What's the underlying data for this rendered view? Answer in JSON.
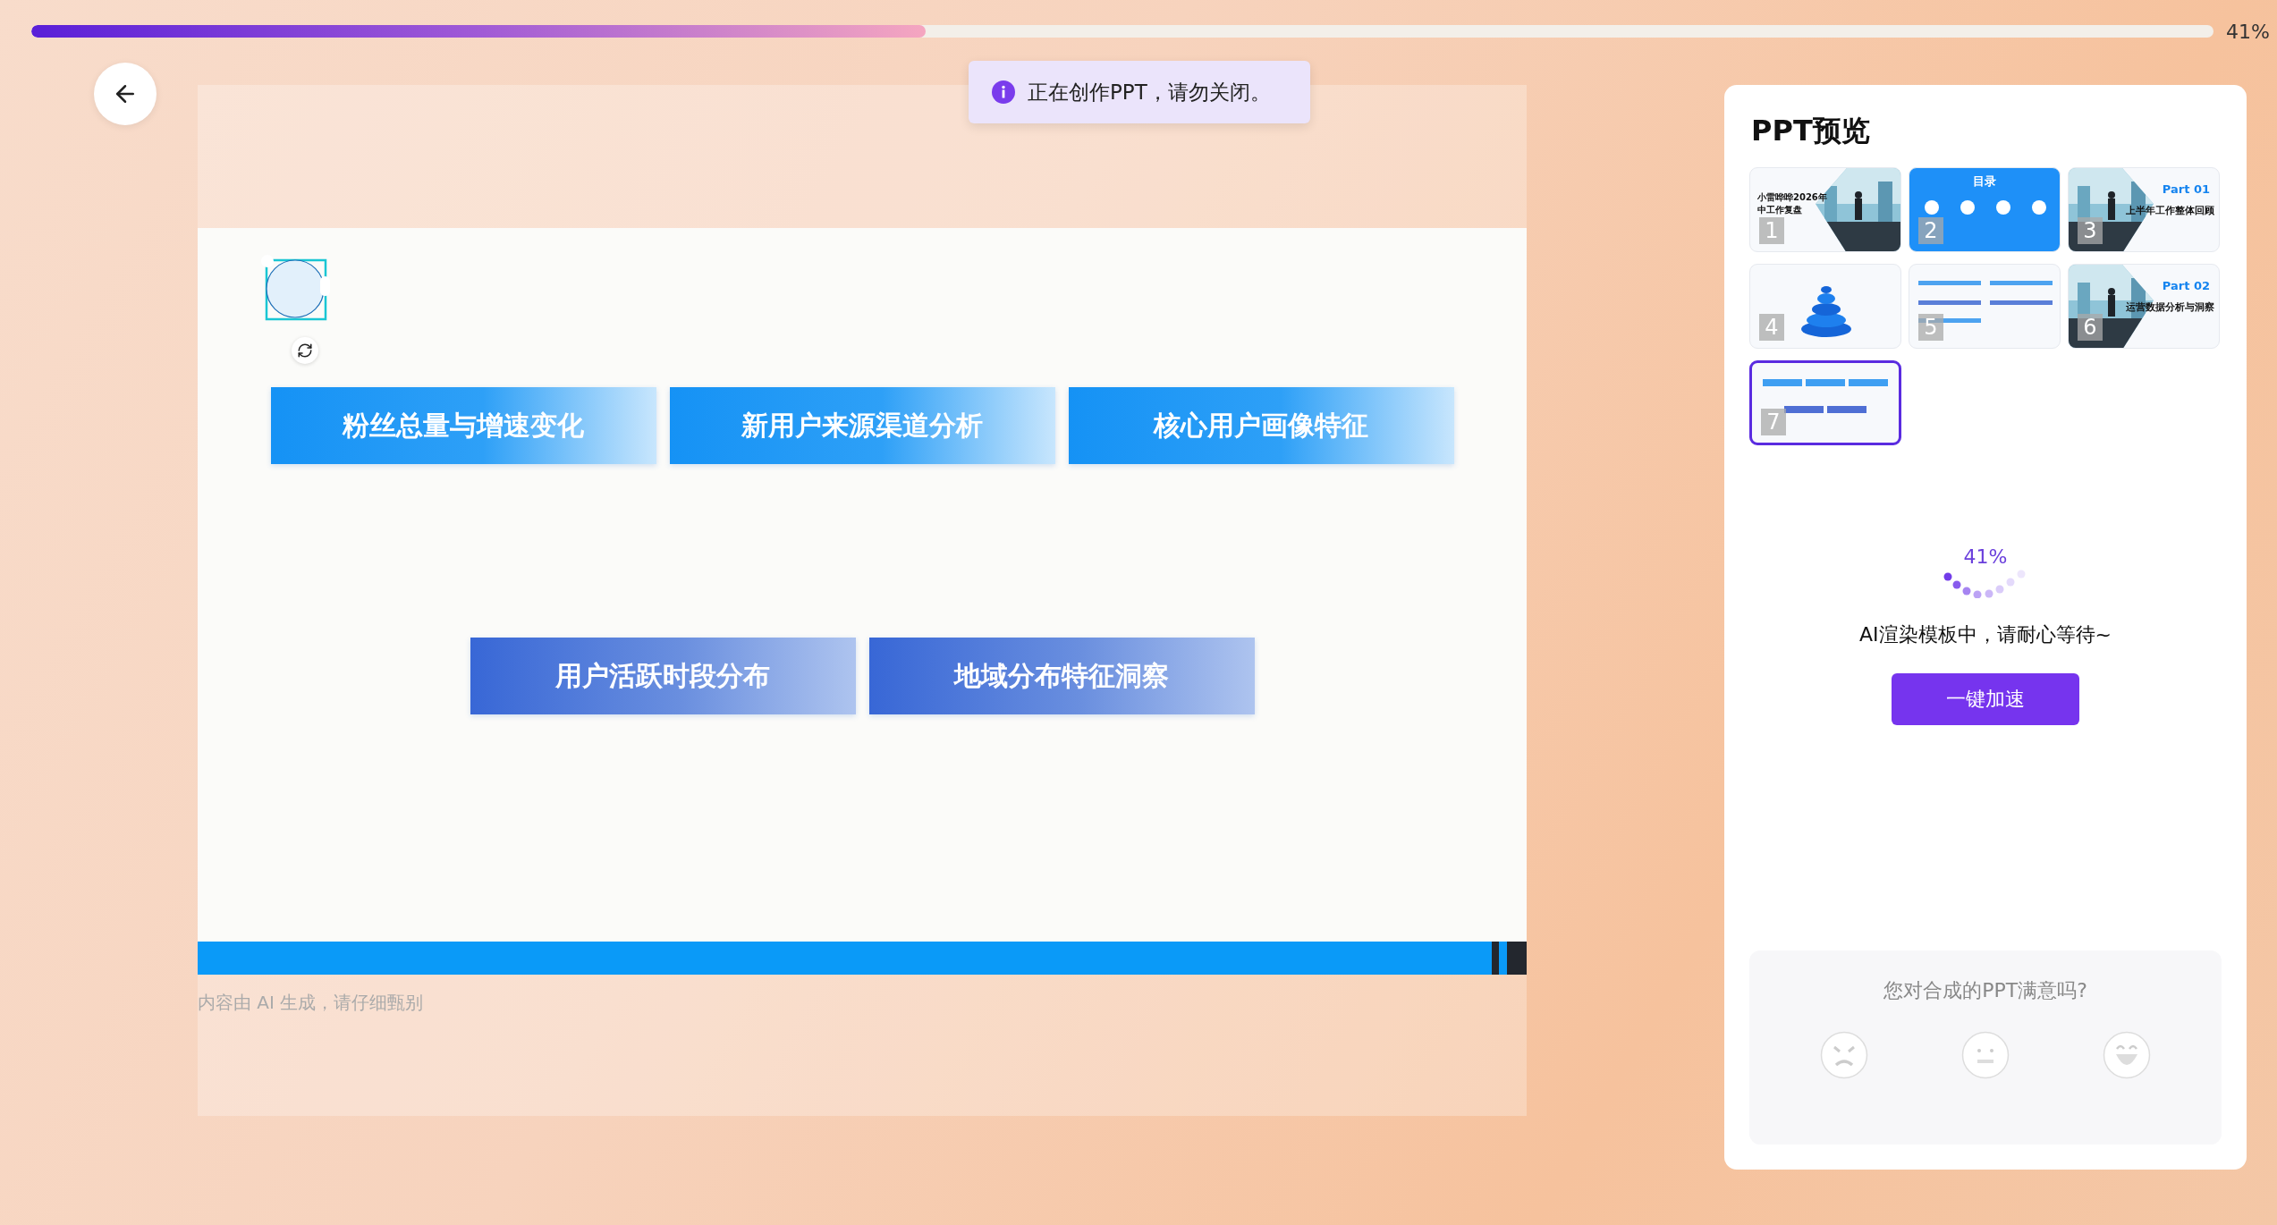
{
  "progress": {
    "level": 0.41,
    "reading": "41%"
  },
  "toast": {
    "text": "正在创作PPT，请勿关闭。"
  },
  "slide": {
    "rows": [
      {
        "kind": "bright",
        "buttons": [
          "粉丝总量与增速变化",
          "新用户来源渠道分析",
          "核心用户画像特征"
        ]
      },
      {
        "kind": "deep",
        "buttons": [
          "用户活跃时段分布",
          "地域分布特征洞察"
        ]
      }
    ],
    "disclaimer": "内容由 AI 生成，请仔细甄别"
  },
  "preview": {
    "title": "PPT预览",
    "thumbnails": [
      {
        "number": "1",
        "kind": "cover",
        "title": "小雷哗哗2026年中工作复盘",
        "selected": false
      },
      {
        "number": "2",
        "kind": "toc",
        "title": "目录",
        "selected": false
      },
      {
        "number": "3",
        "kind": "section",
        "part": "Part 01",
        "title": "上半年工作整体回顾",
        "selected": false
      },
      {
        "number": "4",
        "kind": "pyramid",
        "selected": false
      },
      {
        "number": "5",
        "kind": "bars",
        "selected": false
      },
      {
        "number": "6",
        "kind": "section",
        "part": "Part 02",
        "title": "运营数据分析与洞察",
        "selected": false
      },
      {
        "number": "7",
        "kind": "buttons",
        "selected": true
      }
    ],
    "percent": "41%",
    "status": "AI渲染模板中，请耐心等待~",
    "button": "一键加速"
  },
  "feedback": {
    "question": "您对合成的PPT满意吗?",
    "options": [
      {
        "kind": "angry"
      },
      {
        "kind": "neutral"
      },
      {
        "kind": "happy"
      }
    ]
  }
}
